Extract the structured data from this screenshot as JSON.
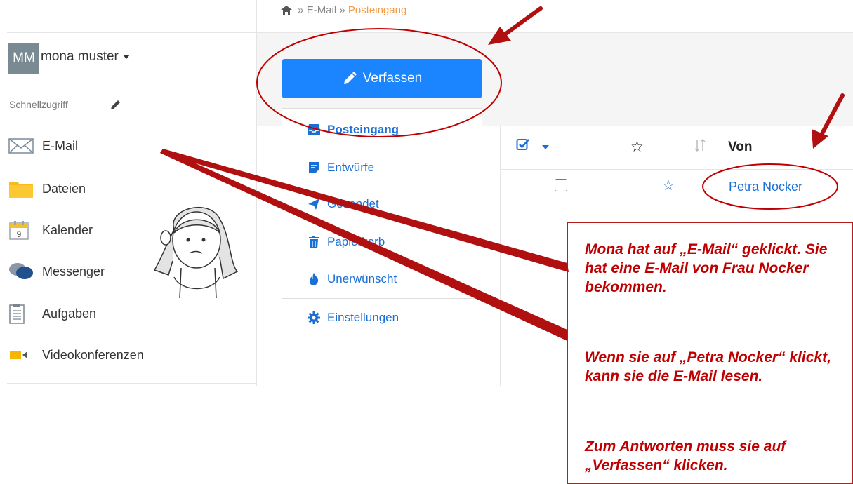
{
  "breadcrumb": {
    "home_sep": "»",
    "mail": "E-Mail",
    "sep2": "»",
    "current": "Posteingang"
  },
  "user": {
    "initials": "MM",
    "name": "mona muster"
  },
  "sidebar": {
    "quick_access_label": "Schnellzugriff",
    "items": [
      {
        "label": "E-Mail",
        "icon": "envelope-icon"
      },
      {
        "label": "Dateien",
        "icon": "folder-icon"
      },
      {
        "label": "Kalender",
        "icon": "calendar-icon"
      },
      {
        "label": "Messenger",
        "icon": "chat-bubbles-icon"
      },
      {
        "label": "Aufgaben",
        "icon": "clipboard-icon"
      },
      {
        "label": "Videokonferenzen",
        "icon": "video-camera-icon"
      }
    ],
    "calendar_day": "9"
  },
  "mail": {
    "compose_label": "Verfassen",
    "folders": [
      {
        "label": "Posteingang",
        "icon": "inbox-icon",
        "active": true
      },
      {
        "label": "Entwürfe",
        "icon": "drafts-icon"
      },
      {
        "label": "Gesendet",
        "icon": "sent-icon"
      },
      {
        "label": "Papierkorb",
        "icon": "trash-icon"
      },
      {
        "label": "Unerwünscht",
        "icon": "flame-icon"
      }
    ],
    "settings_label": "Einstellungen",
    "list": {
      "column_from": "Von",
      "rows": [
        {
          "from": "Petra Nocker",
          "starred": false
        }
      ]
    }
  },
  "annotation": {
    "paragraph1": "Mona hat auf „E-Mail“ geklickt. Sie hat eine E-Mail von Frau Nocker bekommen.",
    "paragraph2": "Wenn sie auf „Petra Nocker“ klickt, kann sie die E-Mail lesen.",
    "paragraph3": "Zum Antworten muss sie auf „Verfassen“ klicken."
  },
  "colors": {
    "primary": "#1a85ff",
    "link": "#1a6fd6",
    "annotation_red": "#c00000",
    "breadcrumb_current": "#f39c47"
  }
}
